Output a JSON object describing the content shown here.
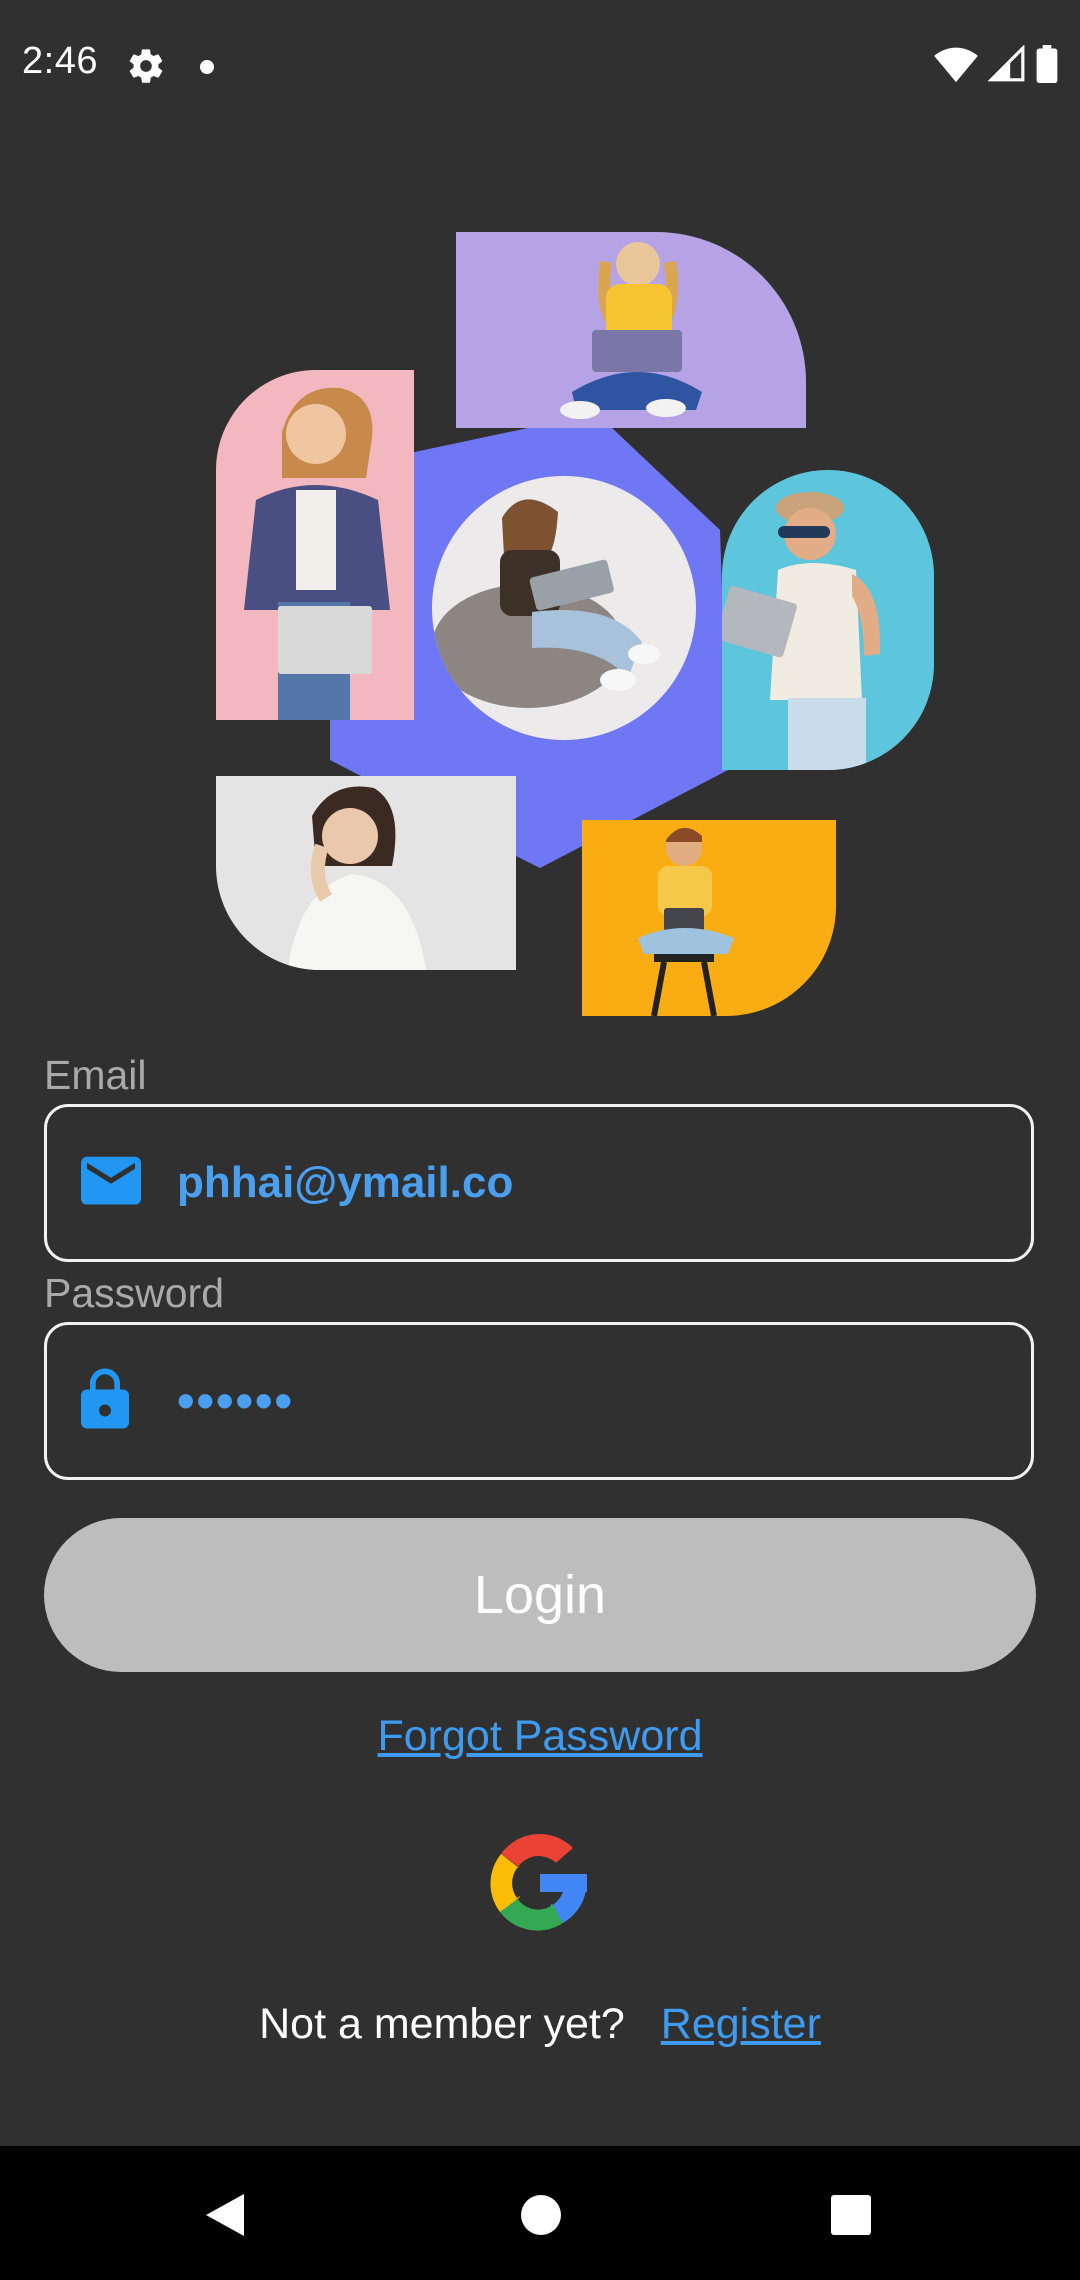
{
  "status_bar": {
    "time": "2:46",
    "icons": [
      "gear-icon",
      "notification-dot-icon",
      "wifi-icon",
      "signal-icon",
      "battery-icon"
    ]
  },
  "hero": {
    "images": [
      "photo-girl-purple-laptop",
      "photo-woman-pink-plaid-shirt",
      "photo-girl-beanbag-laptop",
      "photo-man-cyan-hat-laptop",
      "photo-woman-white-sweater",
      "photo-boy-orange-tablet"
    ],
    "accent_color": "#7077f5"
  },
  "form": {
    "email_label": "Email",
    "email_value": "phhai@ymail.co",
    "password_label": "Password",
    "password_value": "••••••",
    "login_label": "Login",
    "forgot_password": "Forgot Password",
    "google_icon": "google-logo-icon",
    "not_member_text": "Not a member yet?",
    "register_link": "Register"
  },
  "colors": {
    "background": "#303030",
    "link": "#3d9cf1",
    "input_text": "#4aa0ee",
    "button_disabled": "#bdbdbd"
  },
  "nav_bar": {
    "buttons": [
      "back-icon",
      "home-icon",
      "recents-icon"
    ]
  }
}
